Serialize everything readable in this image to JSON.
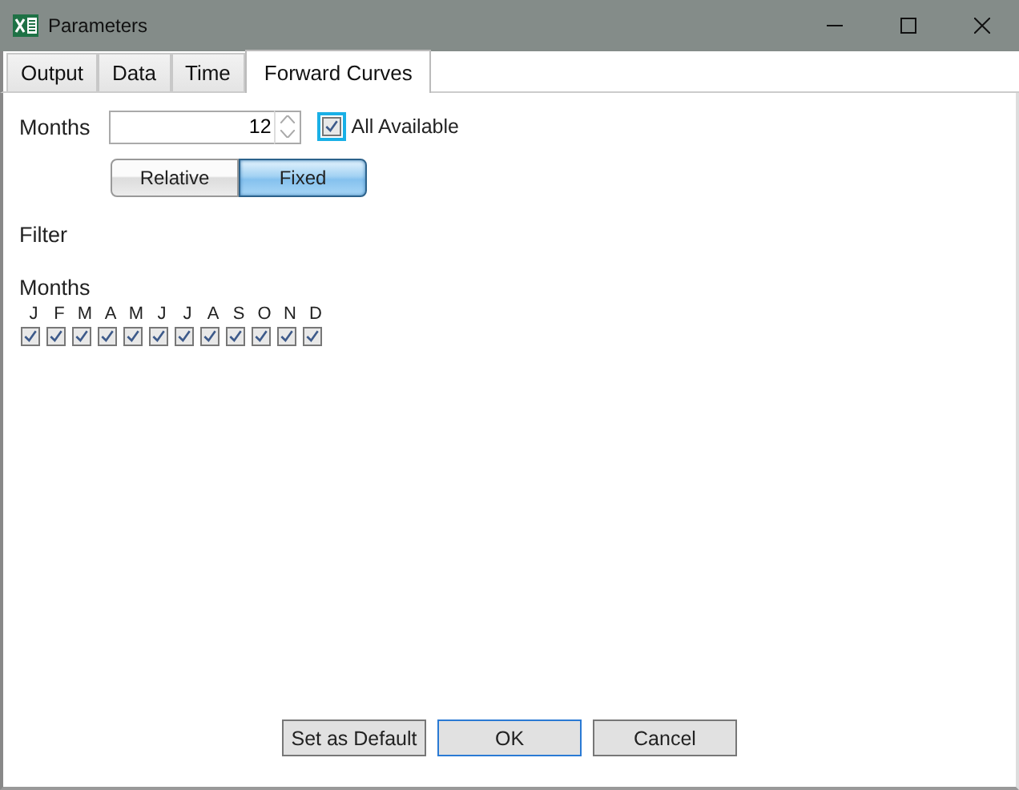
{
  "window": {
    "title": "Parameters"
  },
  "tabs": [
    {
      "label": "Output",
      "selected": false
    },
    {
      "label": "Data",
      "selected": false
    },
    {
      "label": "Time",
      "selected": false
    },
    {
      "label": "Forward Curves",
      "selected": true
    }
  ],
  "months_field": {
    "label": "Months",
    "value": "12"
  },
  "all_available": {
    "label": "All Available",
    "checked": true
  },
  "mode_buttons": [
    {
      "label": "Relative",
      "selected": false
    },
    {
      "label": "Fixed",
      "selected": true
    }
  ],
  "filter": {
    "title": "Filter",
    "months_label": "Months",
    "months": [
      {
        "label": "J",
        "checked": true
      },
      {
        "label": "F",
        "checked": true
      },
      {
        "label": "M",
        "checked": true
      },
      {
        "label": "A",
        "checked": true
      },
      {
        "label": "M",
        "checked": true
      },
      {
        "label": "J",
        "checked": true
      },
      {
        "label": "J",
        "checked": true
      },
      {
        "label": "A",
        "checked": true
      },
      {
        "label": "S",
        "checked": true
      },
      {
        "label": "O",
        "checked": true
      },
      {
        "label": "N",
        "checked": true
      },
      {
        "label": "D",
        "checked": true
      }
    ]
  },
  "buttons": [
    {
      "label": "Set as Default",
      "default": false
    },
    {
      "label": "OK",
      "default": true
    },
    {
      "label": "Cancel",
      "default": false
    }
  ]
}
